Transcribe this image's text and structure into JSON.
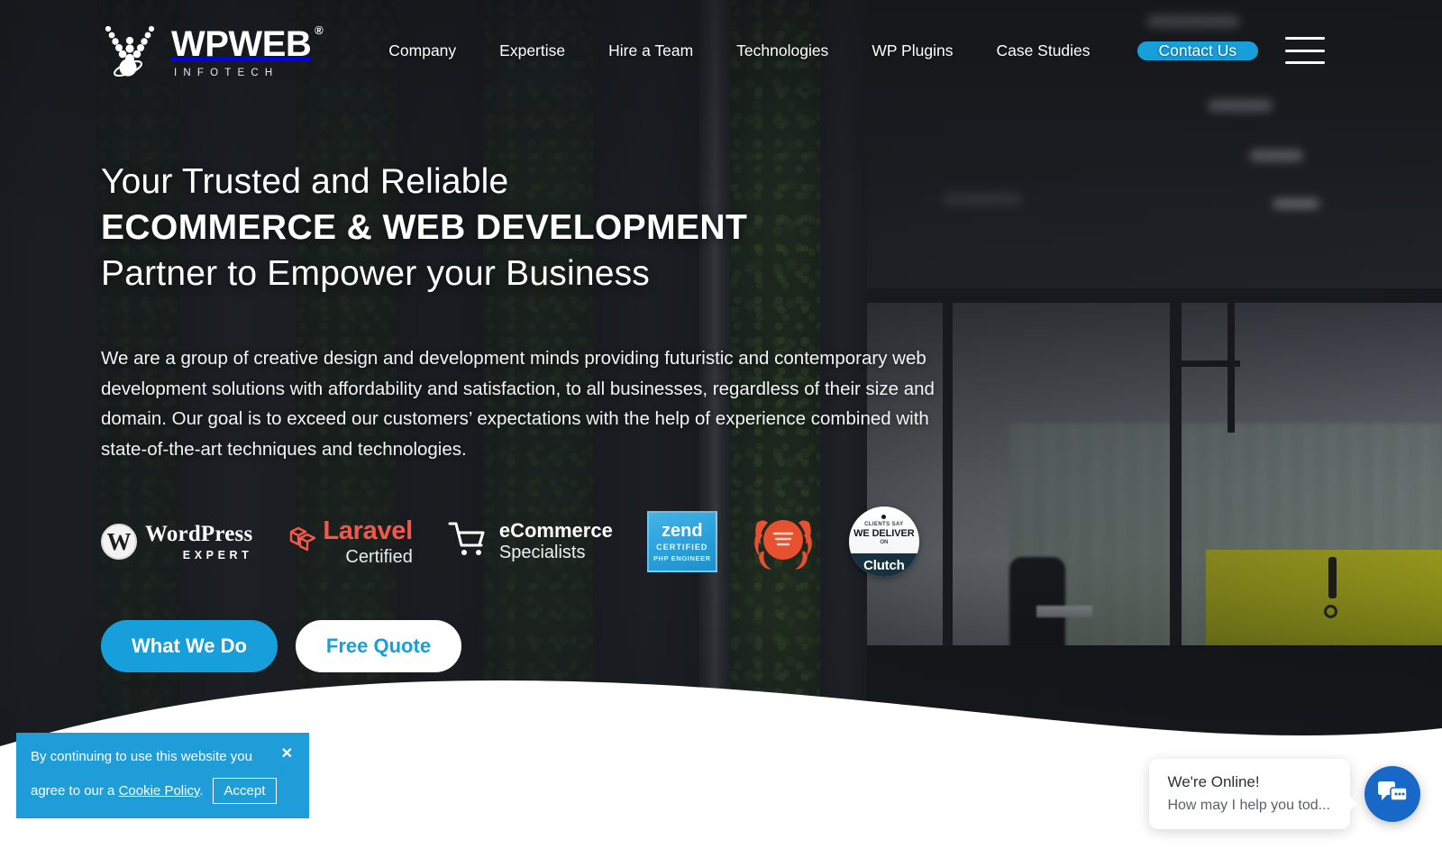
{
  "brand": {
    "name": "WPWEB",
    "registered": "®",
    "tagline": "INFOTECH",
    "logo_icon": "wpweb-orbit-logo-icon"
  },
  "nav": {
    "items": [
      {
        "label": "Company"
      },
      {
        "label": "Expertise"
      },
      {
        "label": "Hire a Team"
      },
      {
        "label": "Technologies"
      },
      {
        "label": "WP Plugins"
      },
      {
        "label": "Case Studies"
      }
    ],
    "contact_label": "Contact Us",
    "menu_icon": "hamburger-menu-icon"
  },
  "hero": {
    "heading_line1": "Your Trusted and Reliable",
    "heading_line2": "ECOMMERCE & WEB DEVELOPMENT",
    "heading_line3": "Partner to Empower your Business",
    "paragraph": "We are a group of creative design and development minds providing futuristic and contemporary web development solutions with affordability and satisfaction, to all businesses, regardless of their size and domain. Our goal is to exceed our customers’ expectations with the help of experience combined with state-of-the-art techniques and technologies.",
    "cta_primary": "What We Do",
    "cta_secondary": "Free Quote"
  },
  "badges": [
    {
      "icon": "wordpress-icon",
      "glyph": "W",
      "line1": "WordPress",
      "line2": "EXPERT"
    },
    {
      "icon": "laravel-icon",
      "line1": "Laravel",
      "line2": "Certified"
    },
    {
      "icon": "shopping-cart-icon",
      "line1": "eCommerce",
      "line2": "Specialists"
    },
    {
      "icon": "zend-icon",
      "line1": "zend",
      "line2": "CERTIFIED",
      "line3": "PHP ENGINEER"
    },
    {
      "icon": "award-laurel-icon",
      "line1": "",
      "line2": ""
    },
    {
      "icon": "clutch-icon",
      "line1": "CLIENTS SAY",
      "line2": "WE DELIVER",
      "line3": "ON",
      "line4": "Clutch"
    }
  ],
  "cookie": {
    "text": "By continuing to use this website you agree to our a",
    "text_line1": "By continuing to use this website you",
    "text_line2": "agree to our a",
    "link_label": "Cookie Policy",
    "period": ".",
    "accept_label": "Accept",
    "close_icon": "close-icon",
    "close_glyph": "✕"
  },
  "chat": {
    "title": "We're Online!",
    "subtitle": "How may I help you tod...",
    "icon": "chat-bubbles-icon"
  },
  "colors": {
    "accent": "#169fdb",
    "cookie_bg": "#1f9dd9",
    "chat_fab": "#1868c8",
    "laravel_red": "#f4584b",
    "zend_blue": "#2ea3dd",
    "clutch_navy": "#17313f",
    "award_orange": "#e8512f",
    "wave_white": "#ffffff"
  }
}
